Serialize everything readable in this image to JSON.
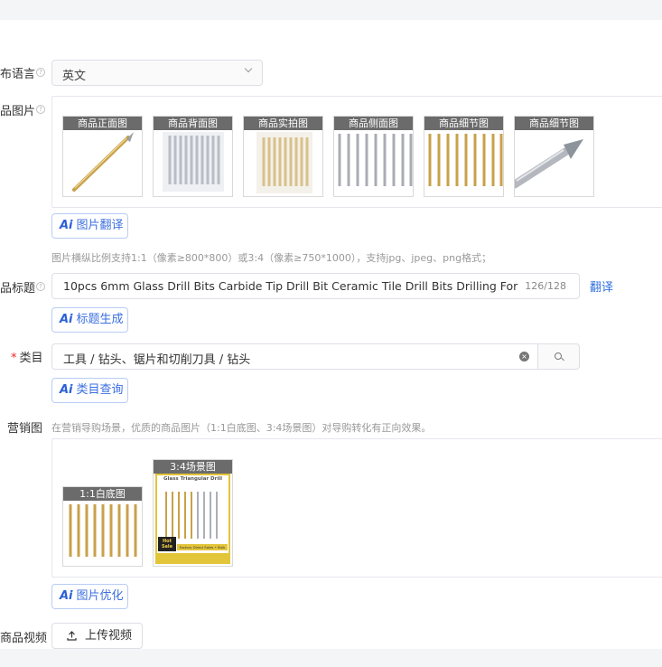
{
  "form": {
    "language": {
      "label": "布语言",
      "value": "英文"
    },
    "images": {
      "label": "品图片",
      "items": [
        {
          "tag": "商品正面图",
          "icon": "single-gold-drill-bit"
        },
        {
          "tag": "商品背面图",
          "icon": "packaged-drill-bits"
        },
        {
          "tag": "商品实拍图",
          "icon": "packaged-gold-drill-bits"
        },
        {
          "tag": "商品侧面图",
          "icon": "silver-drill-bits-row"
        },
        {
          "tag": "商品细节图",
          "icon": "gold-drill-bits-row"
        },
        {
          "tag": "商品细节图",
          "icon": "drill-bit-tip-closeup"
        }
      ],
      "translate_button": "图片翻译",
      "hint": "图片横纵比例支持1:1（像素≥800*800）或3:4（像素≥750*1000），支持jpg、jpeg、png格式；"
    },
    "title": {
      "label": "品标题",
      "value": "10pcs 6mm Glass Drill Bits Carbide Tip Drill Bit Ceramic Tile Drill Bits Drilling For Ceramic Wall",
      "count": "126/128",
      "translate_link": "翻译",
      "generate_button": "标题生成"
    },
    "category": {
      "required_mark": "*",
      "label": "类目",
      "value": "工具 / 钻头、锯片和切削刀具 / 钻头",
      "query_button": "类目查询"
    },
    "marketing": {
      "label": "营销图",
      "hint": "在营销导购场景，优质的商品图片（1:1白底图、3:4场景图）对导购转化有正向效果。",
      "items": [
        {
          "tag": "1:1白底图",
          "icon": "gold-drill-bits-white-bg"
        },
        {
          "tag": "3:4场景图",
          "icon": "drill-bits-scene-poster"
        }
      ],
      "poster_title": "Glass Triangular Drill",
      "poster_badge": "Hot Sale",
      "poster_banner": "Factory Direct Sales • Bulk",
      "optimize_button": "图片优化"
    },
    "video": {
      "label": "商品视频",
      "upload_button": "上传视频"
    }
  },
  "colors": {
    "accent": "#2f6fde",
    "required": "#f5222d",
    "gold": "#c9a14a",
    "tag_bg": "#6b6b6b"
  }
}
